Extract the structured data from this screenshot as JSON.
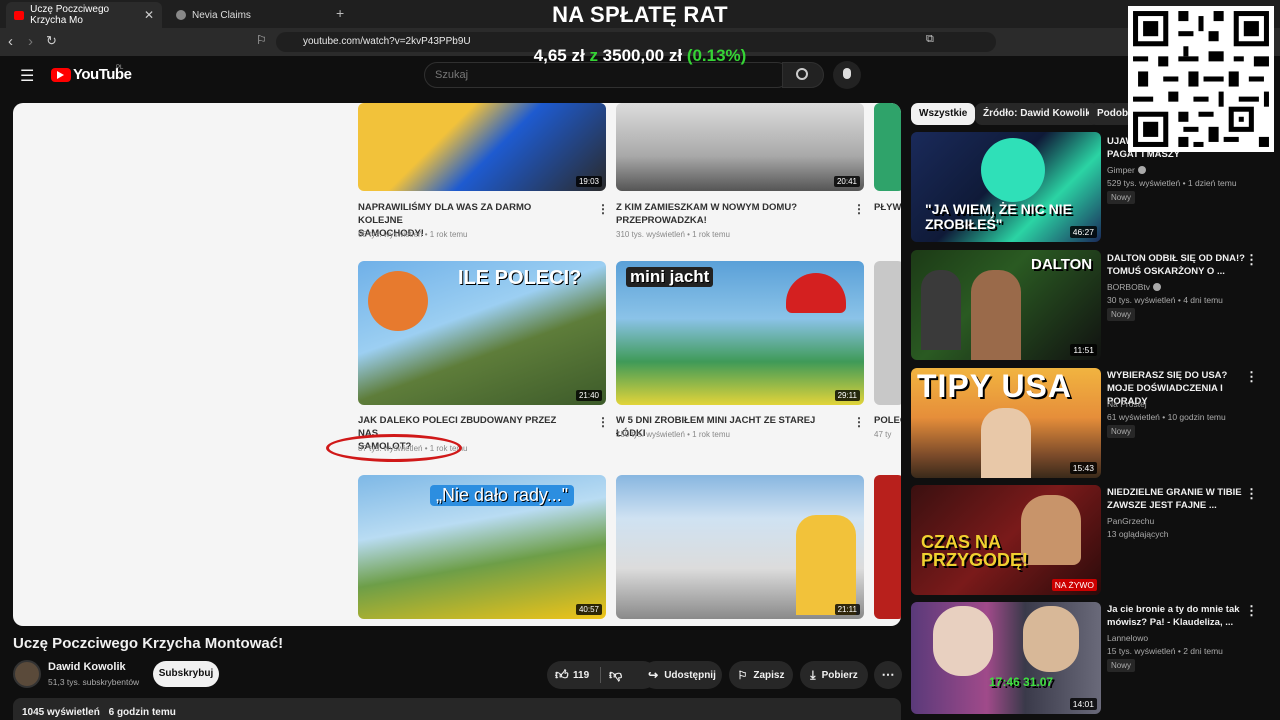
{
  "overlay": {
    "title": "NA SPŁATĘ RAT",
    "amount_current": "4,65 zł",
    "amount_sep": "z",
    "amount_goal": "3500,00 zł",
    "amount_pct": "(0.13%)",
    "pct_color": "#35d435"
  },
  "browser": {
    "tabs": [
      {
        "label": "Uczę Poczciwego Krzycha Mo",
        "active": true
      },
      {
        "label": "Nevia Claims",
        "active": false
      }
    ],
    "new_tab": "+",
    "url": "youtube.com/watch?v=2kvP43PPb9U"
  },
  "youtube": {
    "logo": "YouTube",
    "region": "PL",
    "search_placeholder": "Szukaj"
  },
  "player": {
    "grid": [
      {
        "title_l1": "NAPRAWILIŚMY DLA WAS ZA DARMO KOLEJNE",
        "title_l2": "SAMOCHODY!",
        "meta": "65 tys. wyświetleń • 1 rok temu",
        "duration": "19:03"
      },
      {
        "title_l1": "Z KIM ZAMIESZKAM W NOWYM DOMU?",
        "title_l2": "PRZEPROWADZKA!",
        "meta": "310 tys. wyświetleń • 1 rok temu",
        "duration": "20:41"
      },
      {
        "title_l1": "PŁYWA",
        "title_l2": "",
        "meta": "",
        "duration": ""
      },
      {
        "title_l1": "JAK DALEKO POLECI ZBUDOWANY PRZEZ NAS",
        "title_l2": "SAMOLOT?",
        "meta": "87 tys. wyświetleń • 1 rok temu",
        "duration": "21:40",
        "overlay": "ILE POLECI?"
      },
      {
        "title_l1": "W 5 DNI ZROBIŁEM MINI JACHT ZE STAREJ ŁÓDKI",
        "title_l2": "",
        "meta": "150 tys. wyświetleń • 1 rok temu",
        "duration": "29:11",
        "overlay": "mini jacht"
      },
      {
        "title_l1": "POLEC",
        "title_l2": "",
        "meta": "47 ty",
        "duration": ""
      },
      {
        "title_l1": "",
        "title_l2": "",
        "meta": "",
        "duration": "40:57",
        "overlay": "„Nie dało rady...\""
      },
      {
        "title_l1": "",
        "title_l2": "",
        "meta": "",
        "duration": "21:11"
      }
    ]
  },
  "video": {
    "title": "Uczę Poczciwego Krzycha Montować!",
    "channel": "Dawid Kowolik",
    "subscribers": "51,3 tys. subskrybentów",
    "subscribe_label": "Subskrybuj",
    "likes": "119",
    "share_label": "Udostępnij",
    "save_label": "Zapisz",
    "download_label": "Pobierz",
    "views": "1045 wyświetleń",
    "age": "6 godzin temu"
  },
  "sidebar": {
    "chips": [
      "Wszystkie",
      "Źródło: Dawid Kowolik",
      "Podobne"
    ],
    "items": [
      {
        "title": "UJAWNIAMY NAGRANIA PAGAT I MASZY",
        "channel": "Gimper",
        "verified": true,
        "meta": "529 tys. wyświetleń • 1 dzień temu",
        "badge": "Nowy",
        "duration": "46:27",
        "thumb_text": "\"JA WIEM, ŻE NIC NIE ZROBIŁEŚ\""
      },
      {
        "title": "DALTON ODBIŁ SIĘ OD DNA!? TOMUŚ OSKARŻONY O ...",
        "channel": "BORBOBtv",
        "verified": true,
        "meta": "30 tys. wyświetleń • 4 dni temu",
        "badge": "Nowy",
        "duration": "11:51",
        "thumb_text": "DALTON"
      },
      {
        "title": "WYBIERASZ SIĘ DO USA? MOJE DOŚWIADCZENIA I PORADY",
        "channel": "Na Prostej",
        "verified": false,
        "meta": "61 wyświetleń • 10 godzin temu",
        "badge": "Nowy",
        "duration": "15:43",
        "thumb_text": "TIPY USA"
      },
      {
        "title": "NIEDZIELNE GRANIE W TIBIE ZAWSZE JEST FAJNE ...",
        "channel": "PanGrzechu",
        "verified": false,
        "meta": "13 oglądających",
        "badge": "",
        "duration": "NA ŻYWO",
        "thumb_text": "CZAS NA PRZYGODĘ!"
      },
      {
        "title": "Ja cie bronie a ty do mnie tak mówisz? Pa! - Klaudeliza, ...",
        "channel": "Lannelowo",
        "verified": false,
        "meta": "15 tys. wyświetleń • 2 dni temu",
        "badge": "Nowy",
        "duration": "14:01",
        "thumb_text": "17:46 31.07"
      }
    ]
  }
}
